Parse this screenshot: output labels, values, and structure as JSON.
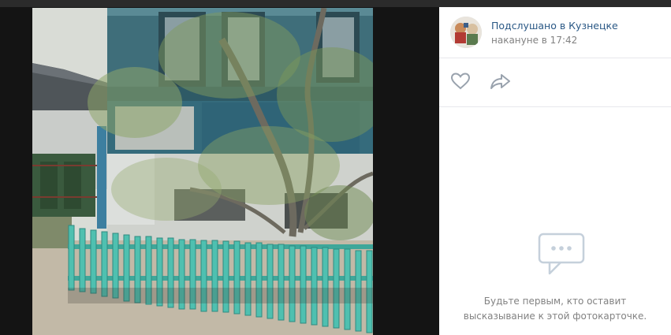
{
  "post": {
    "author_name": "Подслушано в Кузнецке",
    "time": "накануне в 17:42"
  },
  "actions": {
    "like_icon": "heart-icon",
    "share_icon": "share-arrow-icon"
  },
  "comments": {
    "empty_icon": "comment-bubble-icon",
    "empty_line1": "Будьте первым, кто оставит",
    "empty_line2": "высказывание к этой фотокарточке."
  },
  "colors": {
    "link": "#2a5885",
    "muted": "#828282",
    "viewer_background": "#141414",
    "panel_background": "#ffffff",
    "divider": "#e7e8ec"
  }
}
